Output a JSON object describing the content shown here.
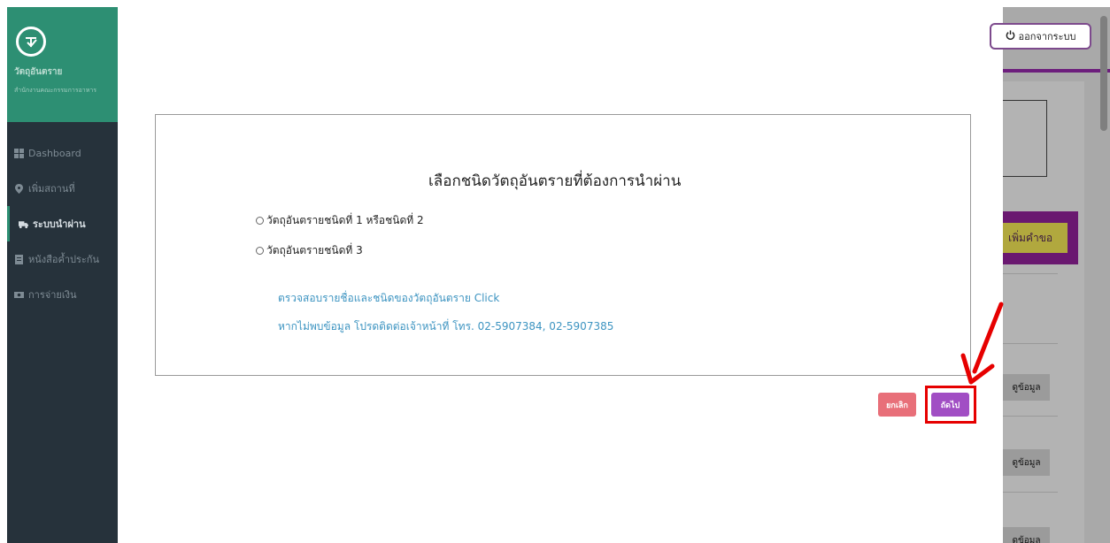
{
  "sidebar": {
    "title": "วัตถุอันตราย",
    "subtitle": "สำนักงานคณะกรรมการอาหาร",
    "items": [
      {
        "label": "Dashboard",
        "icon": "grid-icon"
      },
      {
        "label": "เพิ่มสถานที่",
        "icon": "map-pin-icon"
      },
      {
        "label": "ระบบนำผ่าน",
        "icon": "truck-icon"
      },
      {
        "label": "หนังสือค้ำประกัน",
        "icon": "document-icon"
      },
      {
        "label": "การจ่ายเงิน",
        "icon": "money-icon"
      }
    ]
  },
  "header": {
    "logout_label": "ออกจากระบบ"
  },
  "background": {
    "add_request_label": "เพิ่มคำขอ",
    "view_label": "ดูข้อมูล"
  },
  "dialog": {
    "title": "เลือกชนิดวัตถุอันตรายที่ต้องการนำผ่าน",
    "options": [
      "วัตถุอันตรายชนิดที่ 1 หรือชนิดที่ 2",
      "วัตถุอันตรายชนิดที่ 3"
    ],
    "check_link": "ตรวจสอบรายชื่อและชนิดของวัตถุอันตราย Click",
    "contact_text": "หากไม่พบข้อมูล โปรดติดต่อเจ้าหน้าที่ โทร. 02-5907384, 02-5907385"
  },
  "buttons": {
    "cancel": "ยกเลิก",
    "next": "ถัดไป"
  },
  "colors": {
    "sidebar": "#26323b",
    "brand": "#2d8f73",
    "cancel": "#e86f79",
    "next": "#a14ec4",
    "annotation": "#e60000",
    "link": "#3d94c1"
  }
}
